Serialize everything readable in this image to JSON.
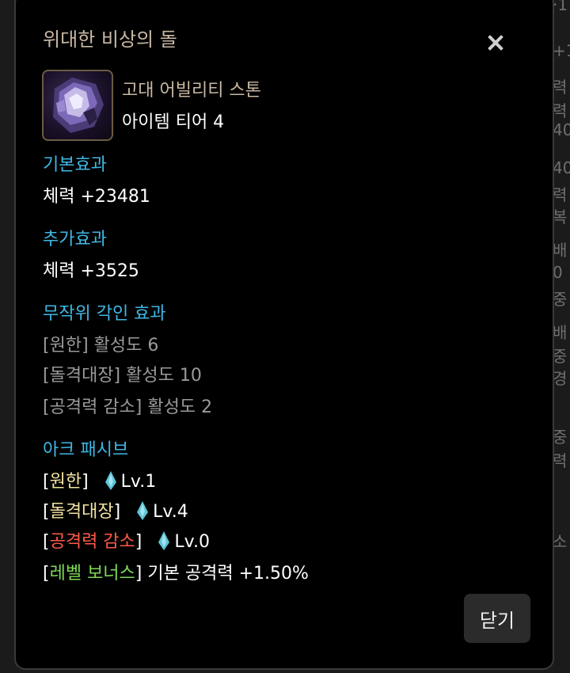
{
  "background_text": [
    "·1",
    "+1",
    "력",
    "력",
    "40",
    "40",
    "력",
    "복",
    "배",
    "0",
    "중",
    "배",
    "중",
    "경",
    "중",
    "력",
    "소"
  ],
  "dialog": {
    "title": "위대한 비상의 돌",
    "close_icon": "close-icon",
    "item": {
      "icon": "purple-stone-icon",
      "name": "고대 어빌리티 스톤",
      "tier": "아이템 티어 4"
    },
    "base_effect": {
      "heading": "기본효과",
      "value": "체력 +23481"
    },
    "extra_effect": {
      "heading": "추가효과",
      "value": "체력 +3525"
    },
    "random_engraving": {
      "heading": "무작위 각인 효과",
      "lines": [
        "[원한] 활성도 6",
        "[돌격대장] 활성도 10",
        "[공격력 감소] 활성도 2"
      ]
    },
    "ark_passive": {
      "heading": "아크 패시브",
      "rows": [
        {
          "open": "[",
          "name": "원한",
          "close": "]",
          "level": "Lv.1",
          "color": "#f3e3a2"
        },
        {
          "open": "[",
          "name": "돌격대장",
          "close": "]",
          "level": "Lv.4",
          "color": "#f3e3a2"
        },
        {
          "open": "[",
          "name": "공격력 감소",
          "close": "]",
          "level": "Lv.0",
          "color": "#ff5a4a"
        }
      ],
      "bonus": {
        "open": "[",
        "name": "레벨 보너스",
        "close": "]",
        "text": " 기본 공격력 +1.50%",
        "color": "#7ed957"
      }
    },
    "close_button": "닫기"
  },
  "colors": {
    "heading": "#3fb8e6",
    "title": "#c9b8a3",
    "gem": "#5fc3d6"
  }
}
